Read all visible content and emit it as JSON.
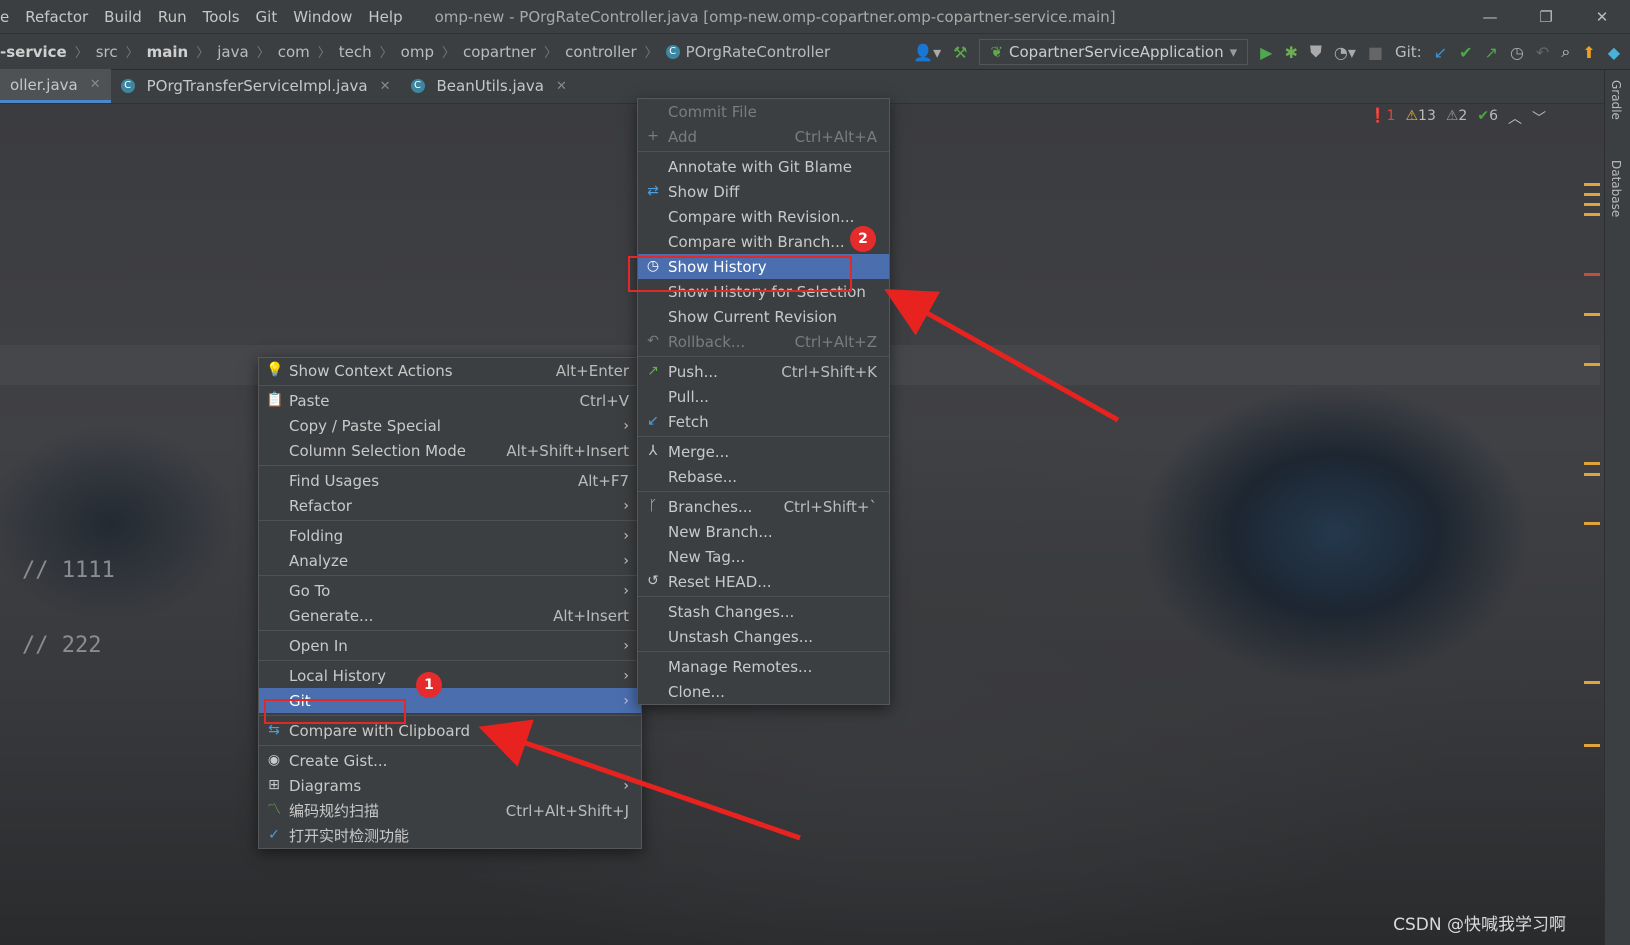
{
  "menubar": {
    "items": [
      "e",
      "Refactor",
      "Build",
      "Run",
      "Tools",
      "Git",
      "Window",
      "Help"
    ],
    "title": "omp-new - POrgRateController.java [omp-new.omp-copartner.omp-copartner-service.main]"
  },
  "window_controls": {
    "minimize": "—",
    "restore": "❐",
    "close": "✕"
  },
  "breadcrumb": [
    "-service",
    "src",
    "main",
    "java",
    "com",
    "tech",
    "omp",
    "copartner",
    "controller",
    "POrgRateController"
  ],
  "toolbar": {
    "run_config": "CopartnerServiceApplication",
    "git_label": "Git:"
  },
  "tabs": [
    {
      "label": "oller.java"
    },
    {
      "label": "POrgTransferServiceImpl.java"
    },
    {
      "label": "BeanUtils.java"
    }
  ],
  "inspections": {
    "errors": "1",
    "warnings": "13",
    "weak_warnings": "2",
    "ok": "6"
  },
  "editor": {
    "lines": [
      "// 1111",
      "// 222"
    ]
  },
  "right_panel": {
    "gradle": "Gradle",
    "database": "Database"
  },
  "context_menu": [
    {
      "label": "Show Context Actions",
      "shortcut": "Alt+Enter",
      "icon": "bulb-icon"
    },
    {
      "sep": true
    },
    {
      "label": "Paste",
      "shortcut": "Ctrl+V",
      "icon": "clipboard-icon"
    },
    {
      "label": "Copy / Paste Special",
      "submenu": true
    },
    {
      "label": "Column Selection Mode",
      "shortcut": "Alt+Shift+Insert"
    },
    {
      "sep": true
    },
    {
      "label": "Find Usages",
      "shortcut": "Alt+F7"
    },
    {
      "label": "Refactor",
      "submenu": true
    },
    {
      "sep": true
    },
    {
      "label": "Folding",
      "submenu": true
    },
    {
      "label": "Analyze",
      "submenu": true
    },
    {
      "sep": true
    },
    {
      "label": "Go To",
      "submenu": true
    },
    {
      "label": "Generate...",
      "shortcut": "Alt+Insert"
    },
    {
      "sep": true
    },
    {
      "label": "Open In",
      "submenu": true
    },
    {
      "sep": true
    },
    {
      "label": "Local History",
      "submenu": true
    },
    {
      "label": "Git",
      "submenu": true,
      "selected": true
    },
    {
      "sep": true
    },
    {
      "label": "Compare with Clipboard",
      "icon": "compare-icon"
    },
    {
      "sep": true
    },
    {
      "label": "Create Gist...",
      "icon": "github-icon"
    },
    {
      "label": "Diagrams",
      "submenu": true,
      "icon": "diagram-icon"
    },
    {
      "label": "编码规约扫描",
      "shortcut": "Ctrl+Alt+Shift+J",
      "icon": "scan-icon"
    },
    {
      "label": "打开实时检测功能",
      "icon": "check-circle-icon"
    }
  ],
  "git_menu": [
    {
      "label": "Commit File",
      "disabled": true
    },
    {
      "label": "Add",
      "shortcut": "Ctrl+Alt+A",
      "disabled": true,
      "icon": "plus-icon"
    },
    {
      "sep": true
    },
    {
      "label": "Annotate with Git Blame"
    },
    {
      "label": "Show Diff",
      "icon": "diff-icon"
    },
    {
      "label": "Compare with Revision..."
    },
    {
      "label": "Compare with Branch..."
    },
    {
      "label": "Show History",
      "selected": true,
      "icon": "clock-icon"
    },
    {
      "label": "Show History for Selection"
    },
    {
      "label": "Show Current Revision"
    },
    {
      "label": "Rollback...",
      "shortcut": "Ctrl+Alt+Z",
      "disabled": true,
      "icon": "undo-icon"
    },
    {
      "sep": true
    },
    {
      "label": "Push...",
      "shortcut": "Ctrl+Shift+K",
      "icon": "push-icon"
    },
    {
      "label": "Pull..."
    },
    {
      "label": "Fetch",
      "icon": "fetch-icon"
    },
    {
      "sep": true
    },
    {
      "label": "Merge...",
      "icon": "merge-icon"
    },
    {
      "label": "Rebase..."
    },
    {
      "sep": true
    },
    {
      "label": "Branches...",
      "shortcut": "Ctrl+Shift+`",
      "icon": "branch-icon"
    },
    {
      "label": "New Branch..."
    },
    {
      "label": "New Tag..."
    },
    {
      "label": "Reset HEAD...",
      "icon": "reset-icon"
    },
    {
      "sep": true
    },
    {
      "label": "Stash Changes..."
    },
    {
      "label": "Unstash Changes..."
    },
    {
      "sep": true
    },
    {
      "label": "Manage Remotes..."
    },
    {
      "label": "Clone..."
    }
  ],
  "annotations": {
    "badge1": "1",
    "badge2": "2"
  },
  "watermark": "CSDN @快喊我学习啊",
  "colors": {
    "selection": "#4b6eaf",
    "highlight": "#e02a2a",
    "menu_bg": "#3c3f41"
  }
}
